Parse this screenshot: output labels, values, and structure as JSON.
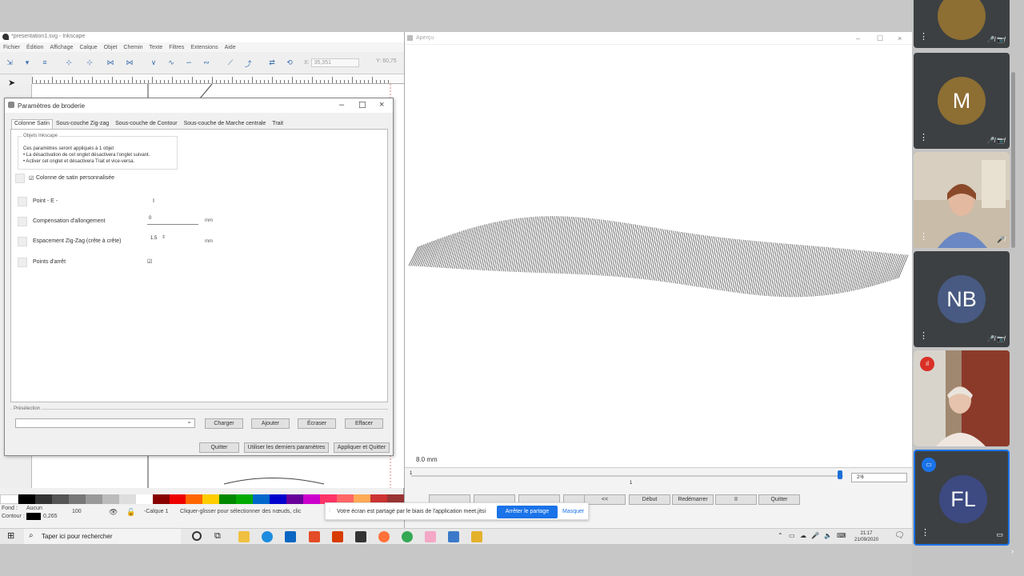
{
  "inkscape": {
    "title": "*presentation1.svg - Inkscape",
    "menu": [
      "Fichier",
      "Édition",
      "Affichage",
      "Calque",
      "Objet",
      "Chemin",
      "Texte",
      "Filtres",
      "Extensions",
      "Aide"
    ],
    "coord_x_label": "X:",
    "coord_x_value": "35,351",
    "coord_y_label": "Y:",
    "coord_y_value": "60,75",
    "status": {
      "fill_label": "Fond :",
      "stroke_label": "Contour :",
      "fill_value": "Aucun",
      "stroke_width": "0,265",
      "opacity_value": "100",
      "layer": "-Calque 1",
      "message": "Cliquer-glisser pour sélectionner des nœuds, clic"
    }
  },
  "dialog": {
    "title": "Paramètres de broderie",
    "tabs": [
      "Colonne Satin",
      "Sous-couche Zig-zag",
      "Sous-couche de Contour",
      "Sous-couche de Marche centrale",
      "Trait"
    ],
    "group_title": "Objets Inkscape",
    "group_lines": [
      "Ces paramètres seront appliqués à 1 objet",
      "• La désactivation de cet onglet désactivera l'onglet suivant.",
      "• Activer cet onglet et désactivera Trait et vice-versa."
    ],
    "custom_satin_label": "Colonne de satin personnalisée",
    "custom_satin_mark": "☑",
    "rows": [
      {
        "label": "Point - E -",
        "value": "I",
        "unit": ""
      },
      {
        "label": "Compensation d'allongement",
        "value": "0",
        "unit": "mm"
      },
      {
        "label": "Espacement Zig-Zag (crête à crête)",
        "value": "1.5",
        "unit": "mm"
      },
      {
        "label": "Points d'arrêt",
        "value": "☑",
        "unit": ""
      }
    ],
    "preset_label": "Présélection",
    "preset_buttons": [
      "Charger",
      "Ajouter",
      "Écraser",
      "Effacer"
    ],
    "footer_buttons": [
      "Quitter",
      "Utiliser les derniers paramètres",
      "Appliquer et Quitter"
    ]
  },
  "preview": {
    "title": "Aperçu",
    "scale": "8.0 mm",
    "slider_start": "1",
    "slider_mark": "1",
    "stitch_count": "2¹6",
    "buttons": [
      "<<",
      "Début",
      "Redémarrer",
      "II",
      "Quitter"
    ]
  },
  "share_banner": {
    "message": "Votre écran est partagé par le biais de l'application meet.jitsi",
    "stop_label": "Arrêter le partage",
    "hide_label": "Masquer"
  },
  "taskbar": {
    "search_placeholder": "Taper ici pour rechercher",
    "time": "21:17",
    "date": "21/09/2020"
  },
  "participants": [
    {
      "initials": "",
      "color": "#3c4043"
    },
    {
      "initials": "M",
      "color": "#8d6e33"
    },
    {
      "initials": "",
      "color": "#3c4043"
    },
    {
      "initials": "NB",
      "color": "#485a82"
    },
    {
      "initials": "",
      "color": "#3c4043"
    },
    {
      "initials": "FL",
      "color": "#3d4a82"
    }
  ],
  "colors": {
    "accent": "#1a73e8",
    "meet_tile": "#3c4043"
  }
}
